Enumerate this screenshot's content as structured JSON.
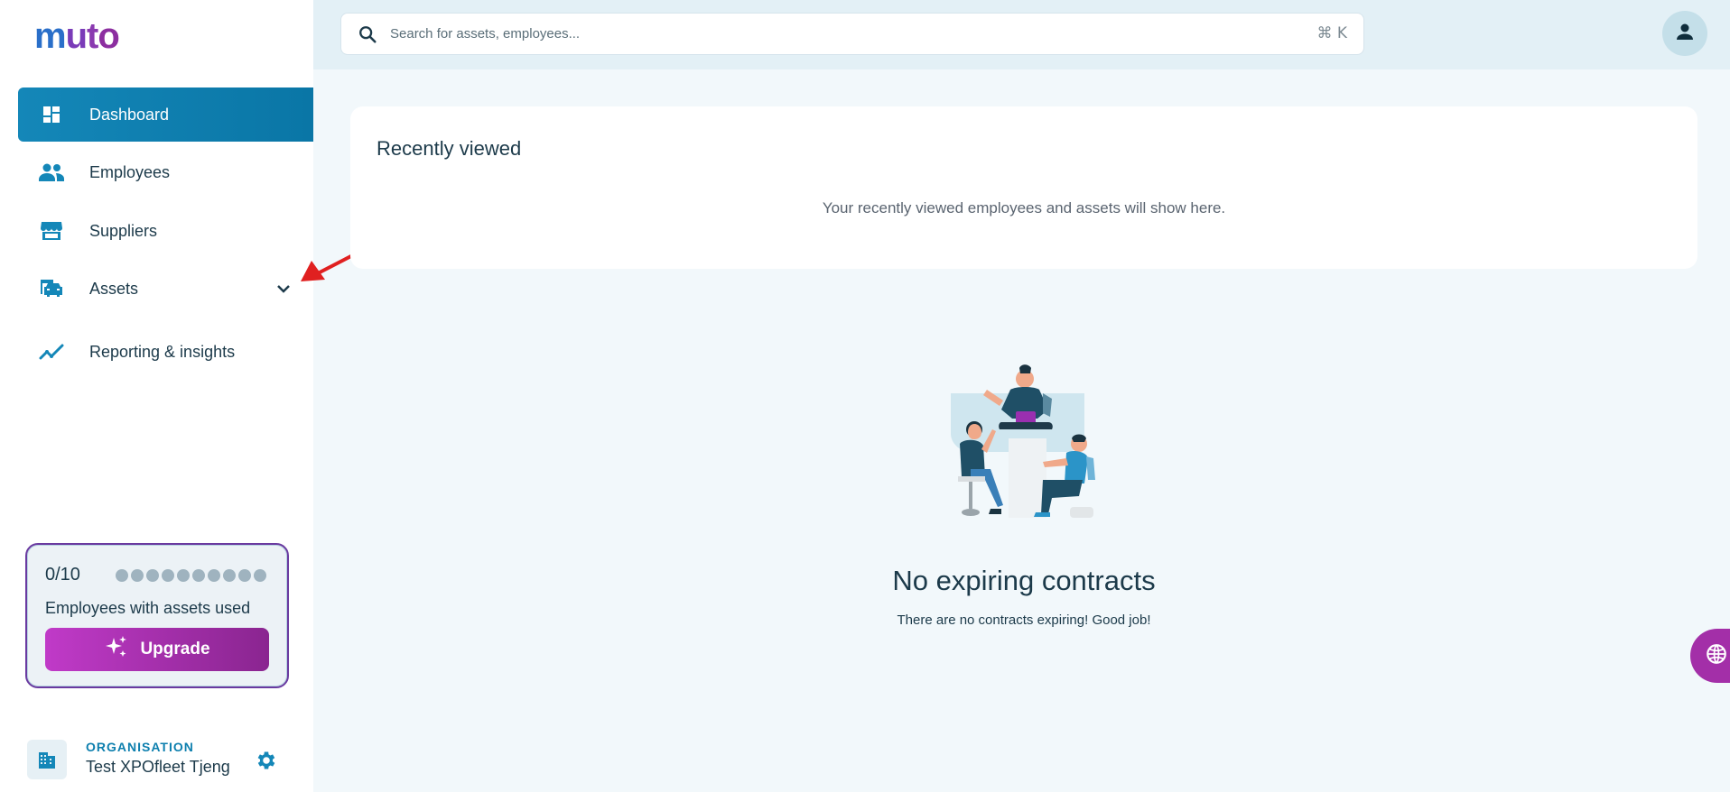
{
  "app": {
    "logo_text": "muto"
  },
  "sidebar": {
    "items": [
      {
        "label": "Dashboard",
        "icon": "dashboard-icon",
        "active": true
      },
      {
        "label": "Employees",
        "icon": "people-icon",
        "active": false
      },
      {
        "label": "Suppliers",
        "icon": "storefront-icon",
        "active": false
      },
      {
        "label": "Assets",
        "icon": "car-icon",
        "active": false,
        "expandable": true
      },
      {
        "label": "Reporting & insights",
        "icon": "trend-line-icon",
        "active": false
      }
    ],
    "usage": {
      "count": "0/10",
      "used": 0,
      "total": 10,
      "label": "Employees with assets used",
      "upgrade_label": "Upgrade"
    },
    "organisation": {
      "caption": "ORGANISATION",
      "name": "Test XPOfleet Tjeng"
    }
  },
  "search": {
    "placeholder": "Search for assets, employees...",
    "shortcut": "⌘ K"
  },
  "recently_viewed": {
    "title": "Recently viewed",
    "empty_text": "Your recently viewed employees and assets will show here."
  },
  "contracts": {
    "empty_title": "No expiring contracts",
    "empty_subtitle": "There are no contracts expiring! Good job!"
  },
  "colors": {
    "accent": "#0d7fae",
    "active_nav": "#1487b8",
    "upgrade": "#a32fa8",
    "annotation_arrow": "#e02020"
  }
}
